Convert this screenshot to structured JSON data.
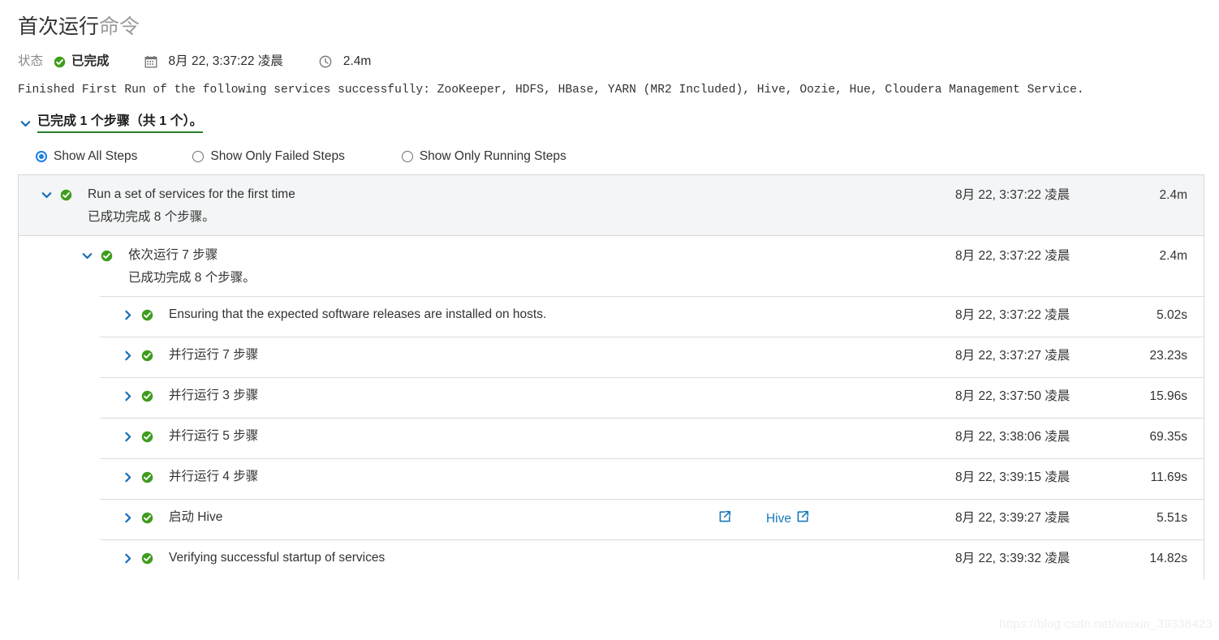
{
  "header": {
    "title_main": "首次运行",
    "title_suffix": "命令",
    "status_label": "状态",
    "status_value": "已完成",
    "started_at": "8月 22, 3:37:22 凌晨",
    "duration": "2.4m",
    "icons": {
      "status": "check-circle-icon",
      "calendar": "calendar-icon",
      "clock": "clock-icon"
    }
  },
  "description": "Finished First Run of the following services successfully: ZooKeeper, HDFS, HBase, YARN (MR2 Included), Hive, Oozie, Hue, Cloudera Management Service.",
  "collapse": {
    "label": "已完成 1 个步骤（共 1 个）。",
    "expanded": true,
    "underline_color": "#2a7d2a"
  },
  "filters": {
    "selected": "Show All Steps",
    "options": [
      {
        "label": "Show All Steps",
        "checked": true
      },
      {
        "label": "Show Only Failed Steps",
        "checked": false
      },
      {
        "label": "Show Only Running Steps",
        "checked": false
      }
    ],
    "accent_color": "#1b7fe3"
  },
  "steps": [
    {
      "level": 1,
      "label": "Run a set of services for the first time",
      "sub": "已成功完成 8 个步骤。",
      "time": "8月 22, 3:37:22 凌晨",
      "duration": "2.4m",
      "expanded": true,
      "status": "success"
    },
    {
      "level": 2,
      "label": "依次运行 7 步骤",
      "sub": "已成功完成 8 个步骤。",
      "time": "8月 22, 3:37:22 凌晨",
      "duration": "2.4m",
      "expanded": true,
      "status": "success"
    },
    {
      "level": 3,
      "label": "Ensuring that the expected software releases are installed on hosts.",
      "sub": "",
      "time": "8月 22, 3:37:22 凌晨",
      "duration": "5.02s",
      "expanded": false,
      "status": "success"
    },
    {
      "level": 3,
      "label": "并行运行 7 步骤",
      "sub": "",
      "time": "8月 22, 3:37:27 凌晨",
      "duration": "23.23s",
      "expanded": false,
      "status": "success"
    },
    {
      "level": 3,
      "label": "并行运行 3 步骤",
      "sub": "",
      "time": "8月 22, 3:37:50 凌晨",
      "duration": "15.96s",
      "expanded": false,
      "status": "success"
    },
    {
      "level": 3,
      "label": "并行运行 5 步骤",
      "sub": "",
      "time": "8月 22, 3:38:06 凌晨",
      "duration": "69.35s",
      "expanded": false,
      "status": "success"
    },
    {
      "level": 3,
      "label": "并行运行 4 步骤",
      "sub": "",
      "time": "8月 22, 3:39:15 凌晨",
      "duration": "11.69s",
      "expanded": false,
      "status": "success"
    },
    {
      "level": 3,
      "label": "启动 Hive",
      "sub": "",
      "time": "8月 22, 3:39:27 凌晨",
      "duration": "5.51s",
      "expanded": false,
      "status": "success",
      "links": [
        {
          "text": "",
          "icon": "external-link-icon"
        },
        {
          "text": "Hive",
          "icon": "external-link-icon"
        }
      ]
    },
    {
      "level": 3,
      "label": "Verifying successful startup of services",
      "sub": "",
      "time": "8月 22, 3:39:32 凌晨",
      "duration": "14.82s",
      "expanded": false,
      "status": "success"
    }
  ],
  "watermark": "https://blog.csdn.net/weixin_39338423"
}
